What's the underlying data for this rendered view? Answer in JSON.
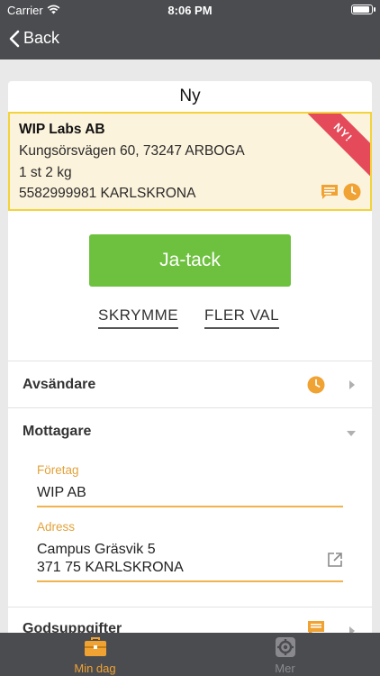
{
  "status_bar": {
    "carrier": "Carrier",
    "time": "8:06 PM",
    "battery_level": 0.95
  },
  "nav": {
    "back_label": "Back"
  },
  "card": {
    "title": "Ny"
  },
  "shipment": {
    "company": "WIP Labs AB",
    "address": "Kungsörsvägen 60, 73247 ARBOGA",
    "package": "1 st 2 kg",
    "reference": "5582999981  KARLSKRONA",
    "badge": "NY!",
    "icons": [
      "message-icon",
      "clock-icon"
    ]
  },
  "actions": {
    "primary": "Ja-tack",
    "skrymme": "SKRYMME",
    "fler_val": "FLER VAL"
  },
  "sections": {
    "avsandare": {
      "label": "Avsändare",
      "icon": "clock-icon"
    },
    "mottagare": {
      "label": "Mottagare",
      "fields": {
        "foretag_label": "Företag",
        "foretag_value": "WIP AB",
        "adress_label": "Adress",
        "adress_line1": "Campus Gräsvik 5",
        "adress_line2": "371 75 KARLSKRONA"
      }
    },
    "godsuppgifter": {
      "label": "Godsuppgifter",
      "icon": "message-icon"
    }
  },
  "tabs": [
    {
      "label": "Min dag",
      "icon": "briefcase-icon",
      "active": true
    },
    {
      "label": "Mer",
      "icon": "gear-icon",
      "active": false
    }
  ],
  "colors": {
    "header": "#4b4c50",
    "accent_orange": "#f0a233",
    "primary_green": "#6ec13f",
    "highlight_yellow": "#f3d33b",
    "ribbon_red": "#e44a59",
    "tab_active": "#f0a233",
    "tab_inactive": "#8a8a8e"
  }
}
